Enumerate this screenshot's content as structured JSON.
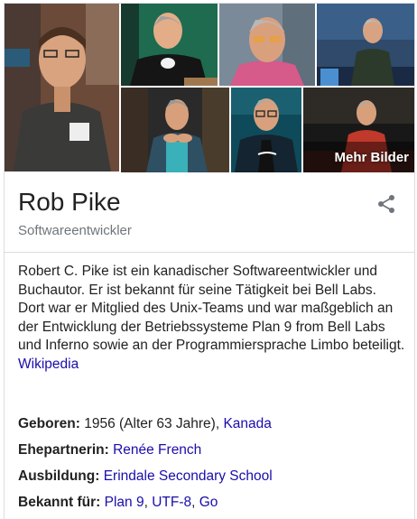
{
  "gallery": {
    "more_label": "Mehr Bilder",
    "photos": [
      {
        "name": "photo-main"
      },
      {
        "name": "photo-2"
      },
      {
        "name": "photo-3"
      },
      {
        "name": "photo-4"
      },
      {
        "name": "photo-5"
      },
      {
        "name": "photo-6"
      },
      {
        "name": "photo-7"
      }
    ]
  },
  "entity": {
    "title": "Rob Pike",
    "subtitle": "Softwareentwickler"
  },
  "description": {
    "text": "Robert C. Pike ist ein kanadischer Softwareentwickler und Buchautor. Er ist bekannt für seine Tätigkeit bei Bell Labs. Dort war er Mitglied des Unix-Teams und war maßgeblich an der Entwicklung der Betriebssysteme Plan 9 from Bell Labs und Inferno sowie an der Programmiersprache Limbo beteiligt.",
    "source_link": "Wikipedia"
  },
  "facts": {
    "born_label": "Geboren:",
    "born_value": "1956 (Alter 63 Jahre),",
    "born_place": "Kanada",
    "spouse_label": "Ehepartnerin:",
    "spouse_value": "Renée French",
    "education_label": "Ausbildung:",
    "education_value": "Erindale Secondary School",
    "known_label": "Bekannt für:",
    "known_items": [
      "Plan 9",
      "UTF-8",
      "Go"
    ],
    "separator": ","
  },
  "colors": {
    "link": "#1a0dab",
    "secondary_text": "#70757a",
    "border": "#dadce0"
  },
  "icons": {
    "share": "share-icon"
  }
}
